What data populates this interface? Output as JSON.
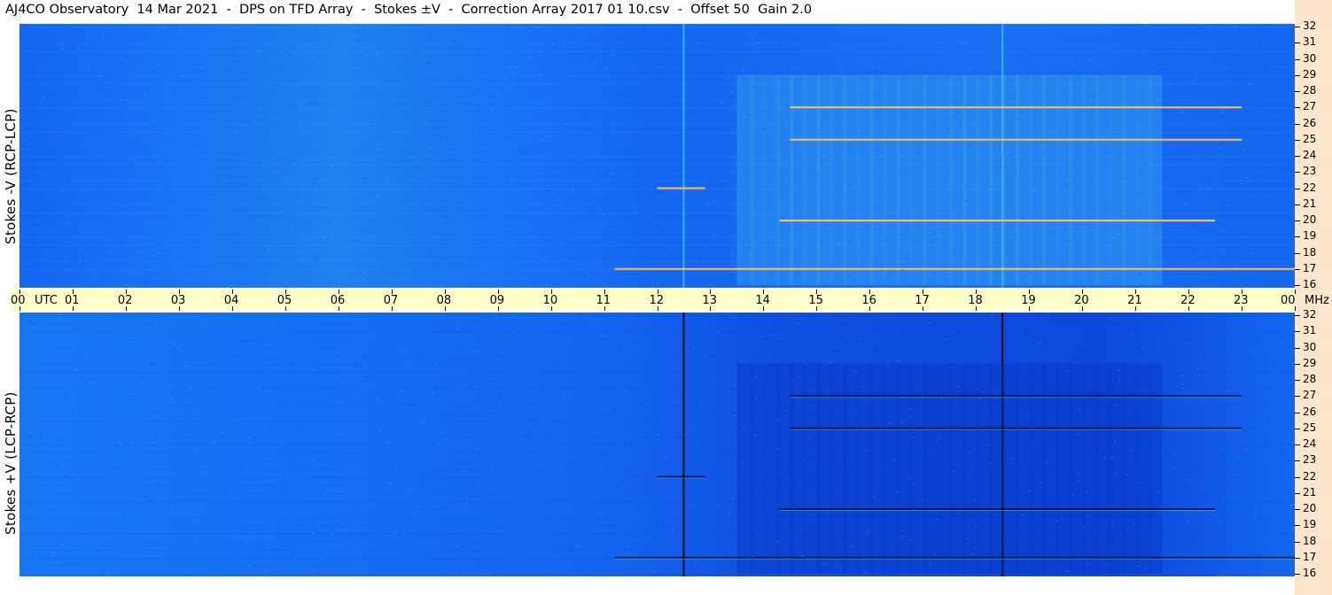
{
  "title": "AJ4CO Observatory  14 Mar 2021  -  DPS on TFD Array  -  Stokes ±V  -  Correction Array 2017 01 10.csv  -  Offset 50  Gain 2.0",
  "panels": {
    "top": {
      "ylabel": "Stokes -V (RCP-LCP)"
    },
    "bottom": {
      "ylabel": "Stokes +V (LCP-RCP)"
    }
  },
  "x_axis": {
    "labels": [
      "00",
      "01",
      "02",
      "03",
      "04",
      "05",
      "06",
      "07",
      "08",
      "09",
      "10",
      "11",
      "12",
      "13",
      "14",
      "15",
      "16",
      "17",
      "18",
      "19",
      "20",
      "21",
      "22",
      "23",
      "00"
    ],
    "utc_label": "UTC",
    "freq_unit": "MHz"
  },
  "y_axis": {
    "labels": [
      "32",
      "31",
      "30",
      "29",
      "28",
      "27",
      "26",
      "25",
      "24",
      "23",
      "22",
      "21",
      "20",
      "19",
      "18",
      "17",
      "16"
    ]
  },
  "colors": {
    "background_deep": "#0a3fd8",
    "background_mid": "#1466f0",
    "background_light": "#29a0f5",
    "time_bar": "#ffffc8",
    "side_strip": "#ffe6cc"
  },
  "chart_data": {
    "type": "heatmap",
    "title": "AJ4CO Observatory  14 Mar 2021  -  DPS on TFD Array  -  Stokes ±V  -  Correction Array 2017 01 10.csv  -  Offset 50  Gain 2.0",
    "xlabel": "UTC",
    "ylabel": "MHz",
    "xlim": [
      0,
      24
    ],
    "ylim": [
      16,
      32
    ],
    "panels": [
      {
        "name": "Stokes -V (RCP-LCP)",
        "polarity": "negative"
      },
      {
        "name": "Stokes +V (LCP-RCP)",
        "polarity": "positive"
      }
    ],
    "features": [
      {
        "kind": "vertical_line",
        "utc_hours": 12.5,
        "panels": "both"
      },
      {
        "kind": "vertical_line",
        "utc_hours": 18.5,
        "panels": "both"
      },
      {
        "kind": "activity_region",
        "utc_start": 13.5,
        "utc_end": 21.5,
        "freq_low": 16,
        "freq_high": 29
      },
      {
        "kind": "horizontal_band",
        "utc_start": 11.2,
        "utc_end": 24,
        "freq": 17
      },
      {
        "kind": "horizontal_band",
        "utc_start": 14.3,
        "utc_end": 22.5,
        "freq": 20
      },
      {
        "kind": "horizontal_band",
        "utc_start": 14.5,
        "utc_end": 23,
        "freq": 25
      },
      {
        "kind": "horizontal_band",
        "utc_start": 14.5,
        "utc_end": 23,
        "freq": 27
      },
      {
        "kind": "horizontal_band",
        "utc_start": 12,
        "utc_end": 12.9,
        "freq": 22
      }
    ]
  }
}
